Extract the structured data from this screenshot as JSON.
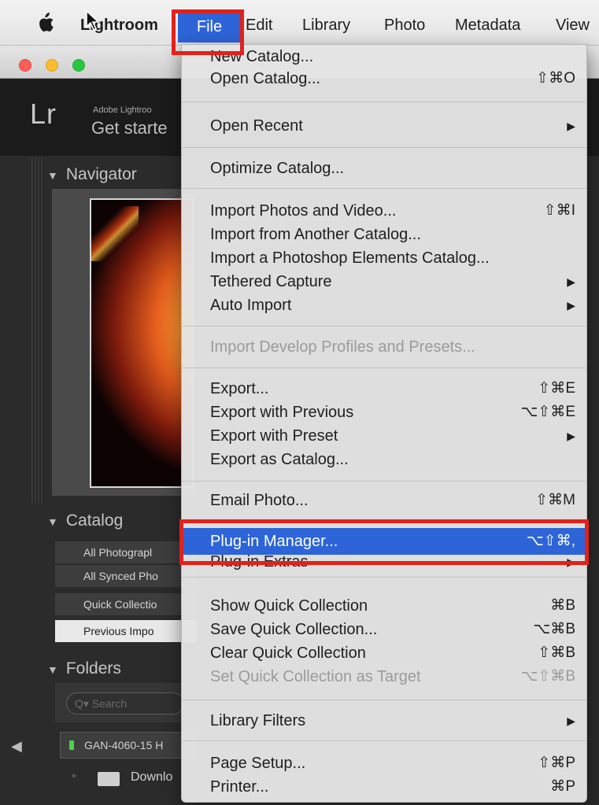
{
  "menubar": {
    "apple_icon": "apple-logo",
    "apple_glyph": "",
    "items": [
      "Lightroom",
      "File",
      "Edit",
      "Library",
      "Photo",
      "Metadata",
      "View"
    ]
  },
  "lightroom": {
    "logo": "Lr",
    "brand": "Adobe Lightroo",
    "tagline": "Get starte",
    "panels": {
      "navigator": "Navigator",
      "catalog": "Catalog",
      "folders": "Folders"
    },
    "catalog_items": [
      "All Photograpl",
      "All Synced Pho",
      "Quick Collectio",
      "Previous Impo"
    ],
    "folders": {
      "search_placeholder": "Q▾ Search",
      "volume": "GAN-4060-15 H",
      "folder": "Downlo"
    },
    "glyphs": {
      "disclosure": "▼",
      "collapse": "◀",
      "folder_arrow": "▸"
    }
  },
  "file_menu": {
    "items": [
      {
        "label": "New Catalog...",
        "shortcut": ""
      },
      {
        "label": "Open Catalog...",
        "shortcut": "⇧⌘O"
      },
      {
        "label": "Open Recent",
        "submenu": true
      },
      {
        "label": "Optimize Catalog...",
        "shortcut": ""
      },
      {
        "label": "Import Photos and Video...",
        "shortcut": "⇧⌘I"
      },
      {
        "label": "Import from Another Catalog...",
        "shortcut": ""
      },
      {
        "label": "Import a Photoshop Elements Catalog...",
        "shortcut": ""
      },
      {
        "label": "Tethered Capture",
        "submenu": true
      },
      {
        "label": "Auto Import",
        "submenu": true
      },
      {
        "label": "Import Develop Profiles and Presets...",
        "disabled": true
      },
      {
        "label": "Export...",
        "shortcut": "⇧⌘E"
      },
      {
        "label": "Export with Previous",
        "shortcut": "⌥⇧⌘E"
      },
      {
        "label": "Export with Preset",
        "submenu": true
      },
      {
        "label": "Export as Catalog...",
        "shortcut": ""
      },
      {
        "label": "Email Photo...",
        "shortcut": "⇧⌘M"
      },
      {
        "label": "Plug-in Manager...",
        "shortcut": "⌥⇧⌘,",
        "highlighted": true
      },
      {
        "label": "Plug-in Extras",
        "submenu": true
      },
      {
        "label": "Show Quick Collection",
        "shortcut": "⌘B"
      },
      {
        "label": "Save Quick Collection...",
        "shortcut": "⌥⌘B"
      },
      {
        "label": "Clear Quick Collection",
        "shortcut": "⇧⌘B"
      },
      {
        "label": "Set Quick Collection as Target",
        "shortcut": "⌥⇧⌘B",
        "disabled": true
      },
      {
        "label": "Library Filters",
        "submenu": true
      },
      {
        "label": "Page Setup...",
        "shortcut": "⇧⌘P"
      },
      {
        "label": "Printer...",
        "shortcut": "⌘P"
      }
    ],
    "submenu_arrow": "▶"
  },
  "colors": {
    "menu_highlight": "#2d64d8",
    "annotation_red": "#e2211c"
  }
}
